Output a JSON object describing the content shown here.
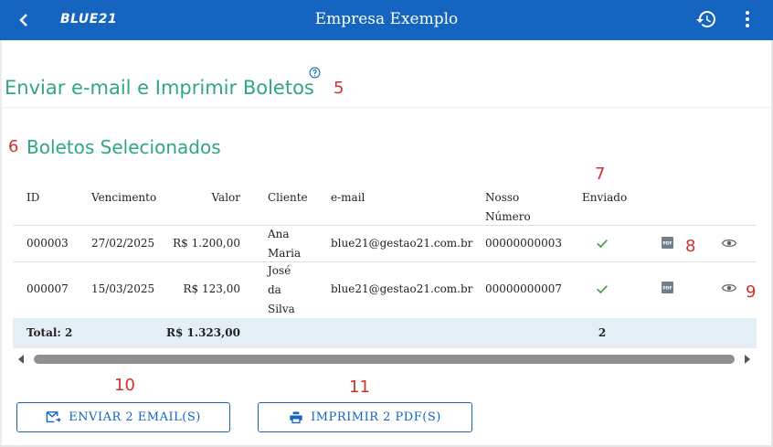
{
  "app": {
    "logo": "BLUE21",
    "title": "Empresa Exemplo"
  },
  "page": {
    "heading": "Enviar e-mail e Imprimir Boletos",
    "section_title": "Boletos Selecionados"
  },
  "annotations": [
    "5",
    "6",
    "7",
    "8",
    "9",
    "10",
    "11"
  ],
  "table": {
    "columns": {
      "id": "ID",
      "vencimento": "Vencimento",
      "valor": "Valor",
      "cliente": "Cliente",
      "email": "e-mail",
      "nosso_numero_1": "Nosso",
      "nosso_numero_2": "Número",
      "enviado": "Enviado"
    },
    "rows": [
      {
        "id": "000003",
        "vencimento": "27/02/2025",
        "valor": "R$ 1.200,00",
        "cliente": [
          "Ana",
          "Maria"
        ],
        "email": "blue21@gestao21.com.br",
        "nosso_numero": "00000000003",
        "enviado": true
      },
      {
        "id": "000007",
        "vencimento": "15/03/2025",
        "valor": "R$ 123,00",
        "cliente": [
          "José",
          "da",
          "Silva"
        ],
        "email": "blue21@gestao21.com.br",
        "nosso_numero": "00000000007",
        "enviado": true
      }
    ],
    "totals": {
      "label": "Total: 2",
      "valor": "R$ 1.323,00",
      "enviado": "2"
    }
  },
  "actions": {
    "send_email": "ENVIAR 2 EMAIL(S)",
    "print_pdf": "IMPRIMIR 2 PDF(S)"
  },
  "icons": {
    "back": "chevron-left-icon",
    "history": "history-icon",
    "more": "more-vert-icon",
    "help": "help-circle-icon",
    "check": "check-icon",
    "pdf": "pdf-icon",
    "view": "eye-icon",
    "email": "email-send-icon",
    "print": "print-icon"
  },
  "colors": {
    "primary": "#1565c0",
    "heading": "#2fa87a",
    "annotation": "#d32f2f",
    "check": "#43a047",
    "total_row": "#e3eef5"
  }
}
